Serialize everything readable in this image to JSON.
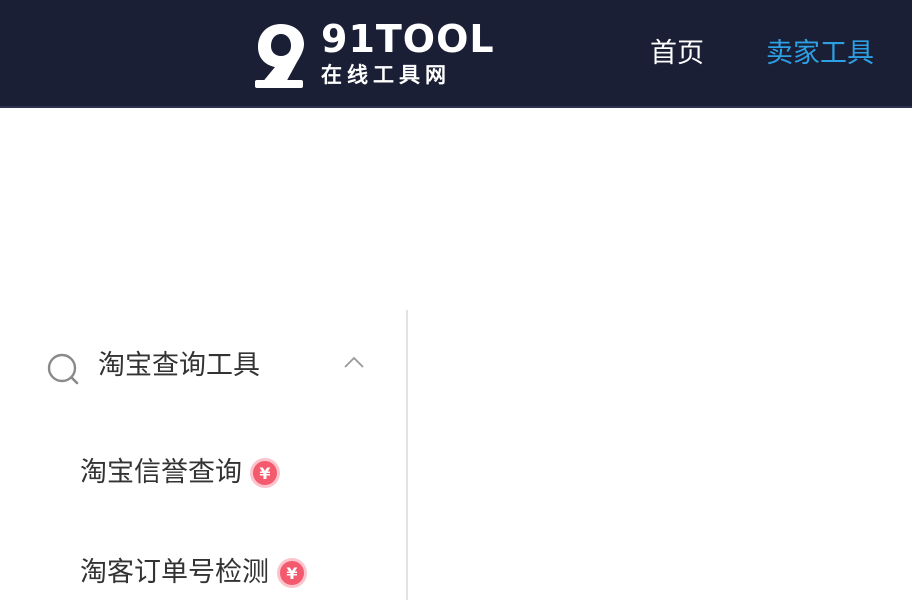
{
  "header": {
    "logo": {
      "name": "91TOOL",
      "subtitle": "在线工具网"
    },
    "nav": [
      {
        "label": "首页",
        "active": false
      },
      {
        "label": "卖家工具",
        "active": true
      }
    ],
    "colors": {
      "background": "#1a1f36",
      "active": "#2d9fe3"
    }
  },
  "sidebar": {
    "group": {
      "title": "淘宝查询工具",
      "icon": "search-icon",
      "expanded": true,
      "items": [
        {
          "label": "淘宝信誉查询",
          "badge": "¥"
        },
        {
          "label": "淘客订单号检测",
          "badge": "¥"
        }
      ]
    },
    "badge_color": "#f45a6d"
  }
}
